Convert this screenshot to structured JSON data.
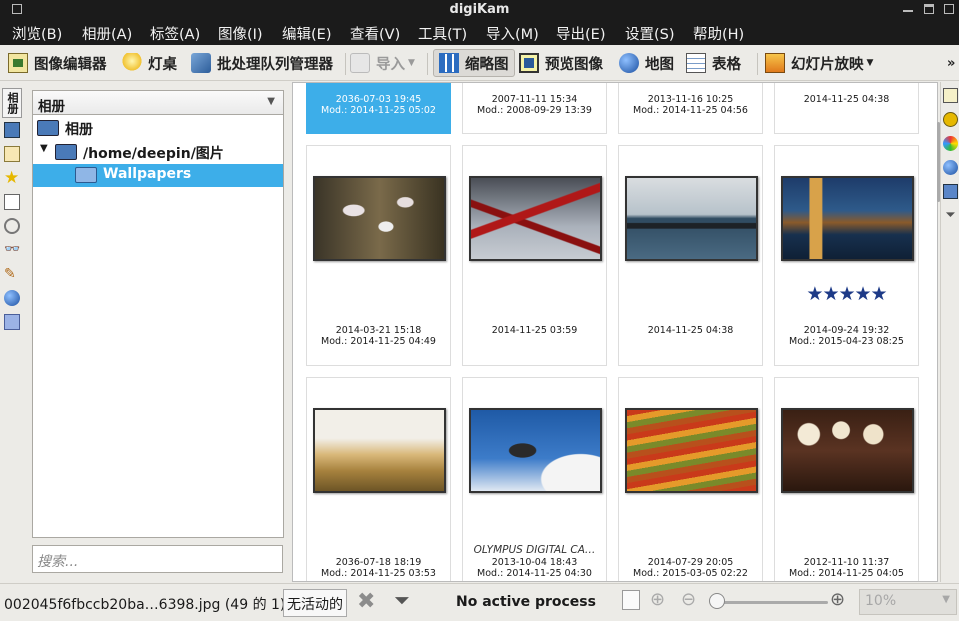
{
  "window": {
    "title": "digiKam"
  },
  "menu": [
    "浏览(B)",
    "相册(A)",
    "标签(A)",
    "图像(I)",
    "编辑(E)",
    "查看(V)",
    "工具(T)",
    "导入(M)",
    "导出(E)",
    "设置(S)",
    "帮助(H)"
  ],
  "toolbar": {
    "image_editor": "图像编辑器",
    "light_table": "灯桌",
    "batch_queue": "批处理队列管理器",
    "import": "导入",
    "thumbnails": "缩略图",
    "preview": "预览图像",
    "map": "地图",
    "table": "表格",
    "slideshow": "幻灯片放映",
    "more": "»"
  },
  "left_tabs": {
    "vertical_label": "相册"
  },
  "album_panel": {
    "combo_label": "相册",
    "tree": [
      {
        "label": "相册",
        "level": 0
      },
      {
        "label": "/home/deepin/图片",
        "level": 1,
        "expanded": true
      },
      {
        "label": "Wallpapers",
        "level": 2,
        "selected": true
      }
    ],
    "search_placeholder": "搜索..."
  },
  "thumbnails": [
    {
      "line1": "",
      "date": "2036-07-03 19:45",
      "mod": "Mod.: 2014-11-25 05:02",
      "selected": true
    },
    {
      "line1": "",
      "date": "2007-11-11 15:34",
      "mod": "Mod.: 2008-09-29 13:39"
    },
    {
      "line1": "",
      "date": "2013-11-16 10:25",
      "mod": "Mod.: 2014-11-25 04:56"
    },
    {
      "line1": "",
      "date": "2014-11-25 04:38",
      "mod": ""
    },
    {
      "line1": "",
      "date": "2014-03-21 15:18",
      "mod": "Mod.: 2014-11-25 04:49",
      "image": "cherry-blossoms"
    },
    {
      "line1": "",
      "date": "2014-11-25 03:59",
      "mod": "",
      "image": "eiffel-tower"
    },
    {
      "line1": "",
      "date": "2014-11-25 04:38",
      "mod": "",
      "image": "cyclist-pier"
    },
    {
      "line1": "",
      "date": "2014-09-24 19:32",
      "mod": "Mod.: 2015-04-23 08:25",
      "image": "venice-canal",
      "rating": 5
    },
    {
      "line1": "",
      "date": "2036-07-18 18:19",
      "mod": "Mod.: 2014-11-25 03:53",
      "image": "wheat-field"
    },
    {
      "line1": "OLYMPUS DIGITAL CA…",
      "date": "2013-10-04 18:43",
      "mod": "Mod.: 2014-11-25 04:30",
      "image": "dead-tree-sky"
    },
    {
      "line1": "",
      "date": "2014-07-29 20:05",
      "mod": "Mod.: 2015-03-05 02:22",
      "image": "terraced-fields"
    },
    {
      "line1": "",
      "date": "2012-11-10 11:37",
      "mod": "Mod.: 2014-11-25 04:05",
      "image": "lanterns-room"
    }
  ],
  "status": {
    "file": "002045f6fbccb20ba…6398.jpg (49 的 1)",
    "filter_button": "无活动的",
    "process": "No active process",
    "zoom": "10%"
  },
  "colors": {
    "accent": "#3daee9",
    "titlebar": "#1b1b1b",
    "star": "#1d3a87"
  }
}
